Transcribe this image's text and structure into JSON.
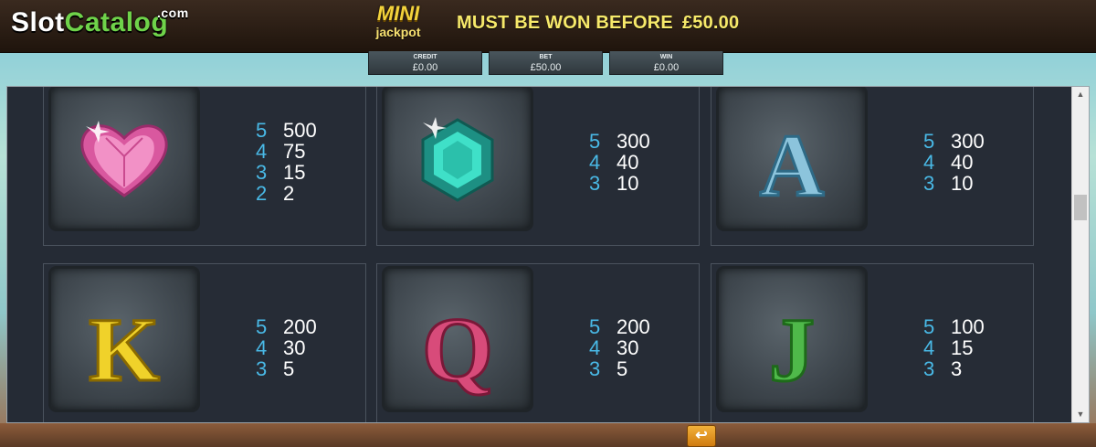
{
  "header": {
    "logo_slot": "Slot",
    "logo_catalog": "Catalog",
    "logo_dotcom": ".com",
    "mini_label": "MINI",
    "jackpot_label": "jackpot",
    "must_be_won_text": "MUST BE WON BEFORE",
    "must_be_won_amount": "£50.00"
  },
  "meters": [
    {
      "label": "CREDIT",
      "value": "£0.00"
    },
    {
      "label": "BET",
      "value": "£50.00"
    },
    {
      "label": "WIN",
      "value": "£0.00"
    }
  ],
  "paytable": [
    {
      "symbol": "heart-gem-icon",
      "color": "#e86ab0",
      "pays": [
        {
          "count": "5",
          "amount": "500"
        },
        {
          "count": "4",
          "amount": "75"
        },
        {
          "count": "3",
          "amount": "15"
        },
        {
          "count": "2",
          "amount": "2"
        }
      ]
    },
    {
      "symbol": "emerald-gem-icon",
      "color": "#1fc7b2",
      "pays": [
        {
          "count": "5",
          "amount": "300"
        },
        {
          "count": "4",
          "amount": "40"
        },
        {
          "count": "3",
          "amount": "10"
        }
      ]
    },
    {
      "symbol": "letter-a-icon",
      "color": "#8cc4dc",
      "letter": "A",
      "pays": [
        {
          "count": "5",
          "amount": "300"
        },
        {
          "count": "4",
          "amount": "40"
        },
        {
          "count": "3",
          "amount": "10"
        }
      ]
    },
    {
      "symbol": "letter-k-icon",
      "color": "#f0d22a",
      "letter": "K",
      "pays": [
        {
          "count": "5",
          "amount": "200"
        },
        {
          "count": "4",
          "amount": "30"
        },
        {
          "count": "3",
          "amount": "5"
        }
      ]
    },
    {
      "symbol": "letter-q-icon",
      "color": "#d84b7a",
      "letter": "Q",
      "pays": [
        {
          "count": "5",
          "amount": "200"
        },
        {
          "count": "4",
          "amount": "30"
        },
        {
          "count": "3",
          "amount": "5"
        }
      ]
    },
    {
      "symbol": "letter-j-icon",
      "color": "#4fb94a",
      "letter": "J",
      "pays": [
        {
          "count": "5",
          "amount": "100"
        },
        {
          "count": "4",
          "amount": "15"
        },
        {
          "count": "3",
          "amount": "3"
        }
      ]
    }
  ],
  "colors": {
    "accent_count": "#49b9e6",
    "panel_bg": "#252b35",
    "gold": "#f6e96a"
  }
}
